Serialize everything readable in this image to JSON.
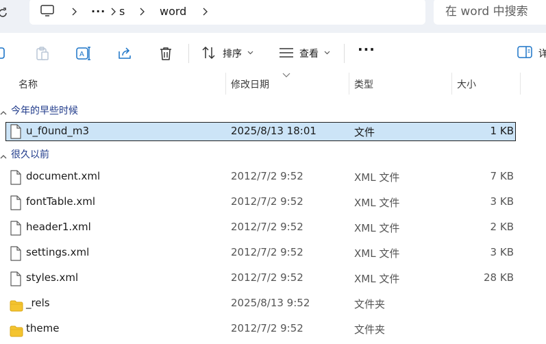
{
  "address_bar": {
    "more_label": "···",
    "crumbs": [
      "s",
      "word"
    ]
  },
  "search": {
    "placeholder": "在 word 中搜索"
  },
  "toolbar": {
    "sort_label": "排序",
    "view_label": "查看",
    "more_label": "···",
    "details_label": "详"
  },
  "columns": {
    "name": "名称",
    "date": "修改日期",
    "type": "类型",
    "size": "大小"
  },
  "groups": [
    {
      "label": "今年的早些时候",
      "items": [
        {
          "name": "u_f0und_m3",
          "date": "2025/8/13 18:01",
          "type": "文件",
          "size": "1 KB",
          "kind": "file",
          "selected": true
        }
      ]
    },
    {
      "label": "很久以前",
      "items": [
        {
          "name": "document.xml",
          "date": "2012/7/2 9:52",
          "type": "XML 文件",
          "size": "7 KB",
          "kind": "file"
        },
        {
          "name": "fontTable.xml",
          "date": "2012/7/2 9:52",
          "type": "XML 文件",
          "size": "3 KB",
          "kind": "file"
        },
        {
          "name": "header1.xml",
          "date": "2012/7/2 9:52",
          "type": "XML 文件",
          "size": "2 KB",
          "kind": "file"
        },
        {
          "name": "settings.xml",
          "date": "2012/7/2 9:52",
          "type": "XML 文件",
          "size": "3 KB",
          "kind": "file"
        },
        {
          "name": "styles.xml",
          "date": "2012/7/2 9:52",
          "type": "XML 文件",
          "size": "28 KB",
          "kind": "file"
        },
        {
          "name": "_rels",
          "date": "2025/8/13 9:52",
          "type": "文件夹",
          "size": "",
          "kind": "folder"
        },
        {
          "name": "theme",
          "date": "2012/7/2 9:52",
          "type": "文件夹",
          "size": "",
          "kind": "folder"
        }
      ]
    }
  ],
  "colors": {
    "selection_bg": "#cce4f7",
    "group_label": "#1f3a8a",
    "chrome_bg": "#eef1f6",
    "folder_yellow": "#f4c430"
  }
}
